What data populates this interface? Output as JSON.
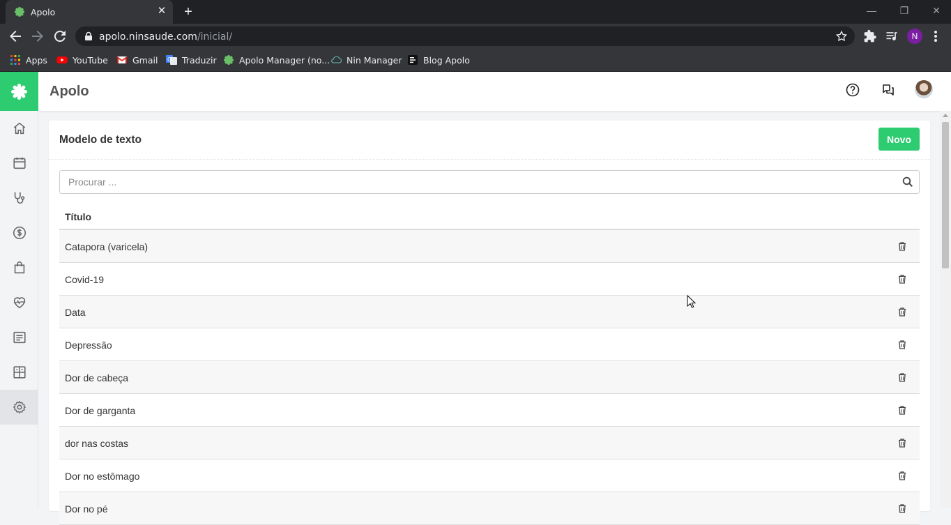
{
  "browser": {
    "tab_title": "Apolo",
    "new_tab_symbol": "+",
    "close_symbol": "✕",
    "url_host": "apolo.ninsaude.com",
    "url_path": "/inicial/",
    "profile_initial": "N",
    "window_controls": {
      "minimize": "—",
      "restore": "❐",
      "close": "✕"
    }
  },
  "bookmarks": [
    {
      "label": "Apps",
      "icon": "apps-grid-icon"
    },
    {
      "label": "YouTube",
      "icon": "youtube-icon"
    },
    {
      "label": "Gmail",
      "icon": "gmail-icon"
    },
    {
      "label": "Traduzir",
      "icon": "translate-icon"
    },
    {
      "label": "Apolo Manager (no...",
      "icon": "apolo-icon"
    },
    {
      "label": "Nin Manager",
      "icon": "cloud-icon"
    },
    {
      "label": "Blog Apolo",
      "icon": "blog-icon"
    }
  ],
  "app": {
    "title": "Apolo",
    "brand_color": "#2ecc71"
  },
  "sidebar": {
    "items": [
      {
        "name": "home",
        "icon": "home-icon"
      },
      {
        "name": "calendar",
        "icon": "calendar-icon"
      },
      {
        "name": "stethoscope",
        "icon": "stethoscope-icon"
      },
      {
        "name": "finance",
        "icon": "dollar-icon"
      },
      {
        "name": "shopping",
        "icon": "bag-icon"
      },
      {
        "name": "health",
        "icon": "heartbeat-icon"
      },
      {
        "name": "reports",
        "icon": "document-icon"
      },
      {
        "name": "dashboard",
        "icon": "grid-icon"
      },
      {
        "name": "settings",
        "icon": "gear-icon",
        "active": true
      }
    ]
  },
  "main": {
    "card_title": "Modelo de texto",
    "new_button": "Novo",
    "search_placeholder": "Procurar ...",
    "column_header": "Título",
    "rows": [
      "Catapora (varicela)",
      "Covid-19",
      "Data",
      "Depressão",
      "Dor de cabeça",
      "Dor de garganta",
      "dor nas costas",
      "Dor no estômago",
      "Dor no pé"
    ]
  }
}
